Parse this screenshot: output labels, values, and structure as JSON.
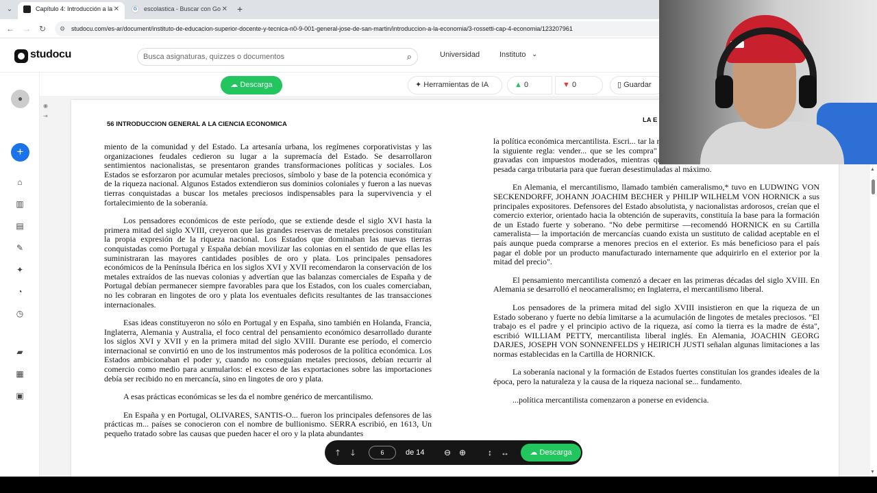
{
  "browser": {
    "tabs": [
      {
        "title": "Capítulo 4: Introducción a la Ec",
        "close": "✕"
      },
      {
        "title": "escolastica - Buscar con Google",
        "close": "✕"
      }
    ],
    "new_tab": "+",
    "url": "studocu.com/es-ar/document/instituto-de-educacion-superior-docente-y-tecnica-n0-9-001-general-jose-de-san-martin/introduccion-a-la-economia/3-rossetti-cap-4-economia/123207961"
  },
  "header": {
    "logo": "studocu",
    "search_placeholder": "Busca asignaturas, quizzes o documentos",
    "links": [
      "Universidad",
      "Instituto"
    ]
  },
  "doc_toolbar": {
    "download": "Descarga",
    "ai_tools": "Herramientas de IA",
    "likes": "0",
    "dislikes": "0",
    "save": "Guardar"
  },
  "document": {
    "left_header": "56   INTRODUCCION GENERAL A LA CIENCIA ECONOMICA",
    "right_header": "LA E",
    "left_paragraphs": [
      "miento de la comunidad y del Estado. La artesanía urbana, los regímenes corporativistas y las organizaciones feudales cedieron su lugar a la supremacía del Estado. Se desarrollaron sentimientos nacionalistas, se presentaron grandes transformaciones políticas y sociales. Los Estados se esforzaron por acumular metales preciosos, símbolo y base de la potencia económica y de la riqueza nacional. Algunos Estados extendieron sus dominios coloniales y fueron a las nuevas tierras conquistadas a buscar los metales preciosos indispensables para la supervivencia y el fortalecimiento de la soberanía.",
      "Los pensadores económicos de este período, que se extiende desde el siglo XVI hasta la primera mitad del siglo XVIII, creyeron que las grandes reservas de metales preciosos constituían la propia expresión de la riqueza nacional. Los Estados que dominaban las nuevas tierras conquistadas como Portugal y España debían movilizar las colonias en el sentido de que ellas les suministraran las mayores cantidades posibles de oro y plata. Los principales pensadores económicos de la Península Ibérica en los siglos XVI y XVII recomendaron la conservación de los metales extraídos de las nuevas colonias y advertían que las balanzas comerciales de España y de Portugal debían permanecer siempre favorables para que los Estados, con los cuales comerciaban, no les cobraran en lingotes de oro y plata los eventuales deficits resultantes de las transacciones internacionales.",
      "Esas ideas constituyeron no sólo en Portugal y en España, sino también en Holanda, Francia, Inglaterra, Alemania y Australia, el foco central del pensamiento económico desarrollado durante los siglos XVI y XVII y en la primera mitad del siglo XVIII. Durante ese período, el comercio internacional se convirtió en uno de los instrumentos más poderosos de la política económica. Los Estados ambicionaban el poder y, cuando no conseguían metales preciosos, debían recurrir al comercio como medio para acumularlos: el exceso de las exportaciones sobre las importaciones debía ser recibido no en mercancía, sino en lingotes de oro y plata.",
      "A esas prácticas económicas se les da el nombre genérico de mercantilismo.",
      "En España y en Portugal, OLIVARES, SANTIS-O... fueron los principales defensores de las prácticas m... países se conocieron con el nombre de bullionismo. SERRA escribió, en 1613, Un pequeño tratado sobre las causas que pueden hacer el oro y la plata abundantes"
    ],
    "right_paragraphs": [
      "la política económica mercantilista. Escri... tar la riqueza y el poder nacionales es... observancia de la siguiente regla: vender... que se les compra\" y argumentó que las exportaciones debían ser gravadas con impuestos moderados, mientras que las importaciones debían ser objeto de una pesada carga tributaria para que fueran desestimuladas al máximo.",
      "En Alemania, el mercantilismo, llamado también cameralismo,* tuvo en LUDWING VON SECKENDORFF, JOHANN JOACHIM BECHER y PHILIP WILHELM VON HORNICK a sus principales expositores. Defensores del Estado absolutista, y nacionalistas ardorosos, creían que el comercio exterior, orientado hacia la obtención de superavits, constituía la base para la formación de un Estado fuerte y soberano. \"No debe permitirse —recomendó HORNICK en su Cartilla cameralista— la importación de mercancías cuando exista un sustituto de calidad aceptable en el país aunque pueda comprarse a menores precios en el exterior. Es más beneficioso para el país pagar el doble por un producto manufacturado internamente que adquirirlo en el exterior por la mitad del precio\".",
      "El pensamiento mercantilista comenzó a decaer en las primeras décadas del siglo XVIII. En Alemania se desarrolló el neocameralismo; en Inglaterra, el mercantilismo liberal.",
      "Los pensadores de la primera mitad del siglo XVIII insistieron en que la riqueza de un Estado soberano y fuerte no debía limitarse a la acumulación de lingotes de metales preciosos. \"El trabajo es el padre y el principio activo de la riqueza, así como la tierra es la madre de ésta\", escribió WILLIAM PETTY, mercantilista liberal inglés. En Alemania, JOACHIN GEORG DARJES, JOSEPH VON SONNENFELDS y HEIRICH JUSTI señalan algunas limitaciones a las normas establecidas en la Cartilla de HORNICK.",
      "La soberanía nacional y la formación de Estados fuertes constituían los grandes ideales de la época, pero la naturaleza y la causa de la riqueza nacional se... fundamento.",
      "...política mercantilista comenzaron a ponerse en evidencia."
    ]
  },
  "pager": {
    "page": "6",
    "of": "de 14",
    "download": "Descarga"
  },
  "icons": {
    "prev": "🡑",
    "next": "🡓",
    "zoom_out": "−",
    "zoom_in": "+"
  }
}
